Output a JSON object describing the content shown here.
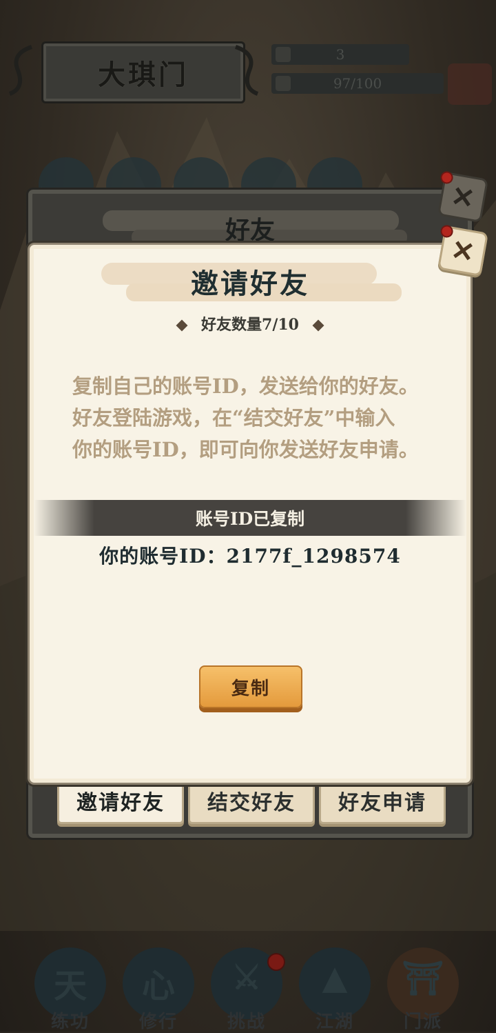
{
  "header": {
    "sect_name": "大琪门",
    "stat_count": "3",
    "stat_progress": "97/100"
  },
  "friends_panel": {
    "title": "好友",
    "tabs": [
      "邀请好友",
      "结交好友",
      "好友申请"
    ]
  },
  "invite_dialog": {
    "title": "邀请好友",
    "friend_count": "好友数量7/10",
    "description": [
      "复制自己的账号ID，发送给你的好友。",
      "好友登陆游戏，在“结交好友”中输入",
      "你的账号ID，即可向你发送好友申请。"
    ],
    "copied_notice": "账号ID已复制",
    "account_id_line": "你的账号ID：2177f_1298574",
    "copy_button": "复制",
    "close_symbol": "✕"
  },
  "bottom_nav": {
    "items": [
      "练功",
      "修行",
      "挑战",
      "江湖",
      "门派"
    ]
  },
  "colors": {
    "dialog_bg": "#f8f3e6",
    "accent_orange": "#e49a3c",
    "text_dark": "#1f2e30",
    "text_muted": "#b39e80"
  }
}
